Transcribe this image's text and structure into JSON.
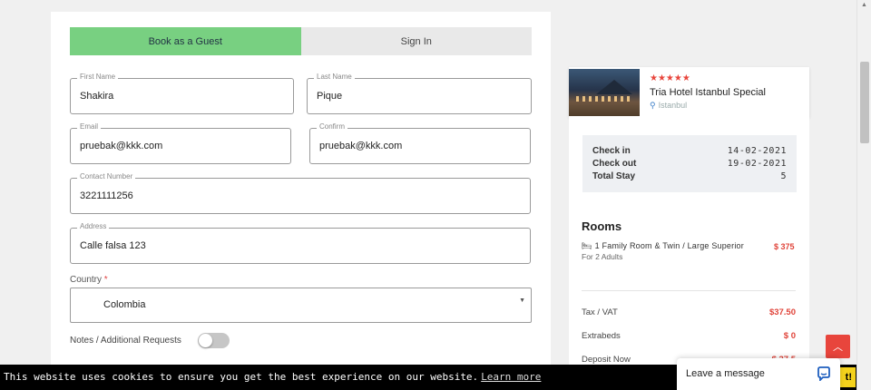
{
  "tabs": {
    "guest": "Book as a Guest",
    "signin": "Sign In"
  },
  "form": {
    "first_name": {
      "label": "First Name",
      "value": "Shakira"
    },
    "last_name": {
      "label": "Last Name",
      "value": "Pique"
    },
    "email": {
      "label": "Email",
      "value": "pruebak@kkk.com"
    },
    "confirm": {
      "label": "Confirm",
      "value": "pruebak@kkk.com"
    },
    "contact": {
      "label": "Contact Number",
      "value": "3221111256"
    },
    "address": {
      "label": "Address",
      "value": "Calle falsa 123"
    },
    "country": {
      "label": "Country",
      "required_mark": "*",
      "value": "Colombia"
    },
    "notes_label": "Notes / Additional Requests",
    "notes_enabled": false
  },
  "hotel": {
    "stars": "★★★★★",
    "name": "Tria Hotel Istanbul Special",
    "location": "Istanbul"
  },
  "stay": {
    "checkin_label": "Check in",
    "checkin": "14-02-2021",
    "checkout_label": "Check out",
    "checkout": "19-02-2021",
    "total_label": "Total Stay",
    "total": "5"
  },
  "rooms": {
    "title": "Rooms",
    "line": "1 Family Room & Twin / Large Superior",
    "price": "$ 375",
    "sub": "For 2 Adults"
  },
  "costs": {
    "tax_label": "Tax / VAT",
    "tax": "$37.50",
    "extrabeds_label": "Extrabeds",
    "extrabeds": "$ 0",
    "deposit_label": "Deposit Now",
    "deposit": "$ 37.5"
  },
  "cookie": {
    "text": "This website uses cookies to ensure you get the best experience on our website.",
    "link": "Learn more",
    "button": "t!"
  },
  "chat": {
    "label": "Leave a message"
  },
  "colors": {
    "accent": "#e8453c",
    "guest_tab": "#78d081",
    "cookie_button": "#f4d21c"
  }
}
